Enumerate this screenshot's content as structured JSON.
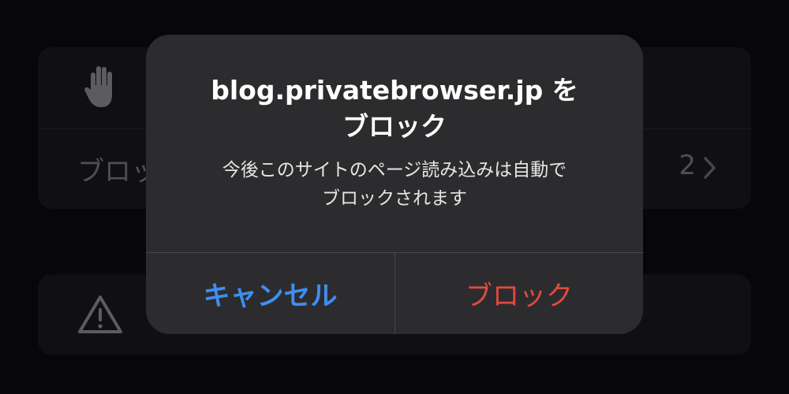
{
  "background": {
    "blocked_row": {
      "label": "ブロッ",
      "count": "2"
    }
  },
  "alert": {
    "title_line1": "blog.privatebrowser.jp を",
    "title_line2": "ブロック",
    "message_line1": "今後このサイトのページ読み込みは自動で",
    "message_line2": "ブロックされます",
    "cancel_label": "キャンセル",
    "block_label": "ブロック"
  },
  "colors": {
    "cancel": "#3f8ef0",
    "destructive": "#e24b40"
  },
  "icons": {
    "hand": "hand-raised-icon",
    "chevron": "chevron-right-icon",
    "warning": "warning-triangle-icon"
  }
}
